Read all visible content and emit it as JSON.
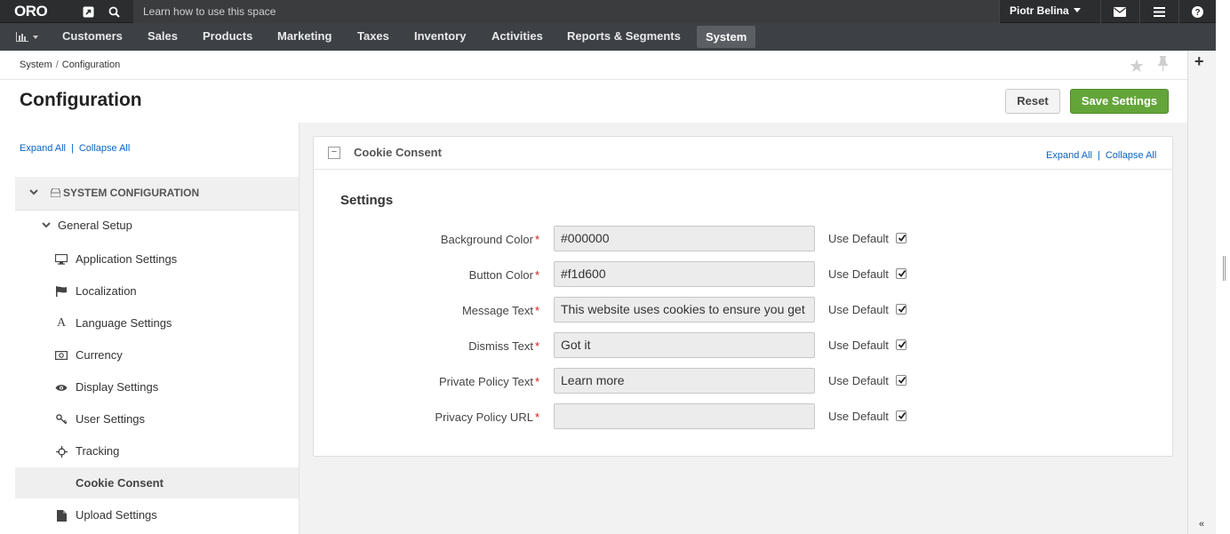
{
  "topbar": {
    "logo": "ORO",
    "hint": "Learn how to use this space",
    "user": "Piotr Belina"
  },
  "nav": {
    "items": [
      "Customers",
      "Sales",
      "Products",
      "Marketing",
      "Taxes",
      "Inventory",
      "Activities",
      "Reports & Segments",
      "System"
    ],
    "active": "System"
  },
  "breadcrumb": {
    "parent": "System",
    "sep": "/",
    "current": "Configuration"
  },
  "page": {
    "title": "Configuration",
    "reset_label": "Reset",
    "save_label": "Save Settings"
  },
  "sidebar": {
    "expand_all": "Expand All",
    "separator": "|",
    "collapse_all": "Collapse All",
    "root": "SYSTEM CONFIGURATION",
    "group": "General Setup",
    "items": [
      {
        "label": "Application Settings",
        "icon": "monitor-icon"
      },
      {
        "label": "Localization",
        "icon": "flag-icon"
      },
      {
        "label": "Language Settings",
        "icon": "font-icon"
      },
      {
        "label": "Currency",
        "icon": "money-icon"
      },
      {
        "label": "Display Settings",
        "icon": "eye-icon"
      },
      {
        "label": "User Settings",
        "icon": "key-icon"
      },
      {
        "label": "Tracking",
        "icon": "crosshairs-icon"
      },
      {
        "label": "Cookie Consent",
        "icon": ""
      },
      {
        "label": "Upload Settings",
        "icon": "file-icon"
      }
    ],
    "active": "Cookie Consent"
  },
  "panel": {
    "title": "Cookie Consent",
    "collapse_glyph": "−",
    "expand_all": "Expand All",
    "separator": "|",
    "collapse_all": "Collapse All",
    "section": "Settings",
    "use_default_label": "Use Default",
    "required_mark": "*",
    "fields": [
      {
        "label": "Background Color",
        "value": "#000000",
        "use_default": true
      },
      {
        "label": "Button Color",
        "value": "#f1d600",
        "use_default": true
      },
      {
        "label": "Message Text",
        "value": "This website uses cookies to ensure you get",
        "use_default": true
      },
      {
        "label": "Dismiss Text",
        "value": "Got it",
        "use_default": true
      },
      {
        "label": "Private Policy Text",
        "value": "Learn more",
        "use_default": true
      },
      {
        "label": "Privacy Policy URL",
        "value": "",
        "use_default": true
      }
    ]
  },
  "colors": {
    "topbar": "#2b2d2f",
    "navbar": "#3d4045",
    "link": "#0b63c4",
    "save": "#64a53a",
    "required": "#c81e1e"
  }
}
